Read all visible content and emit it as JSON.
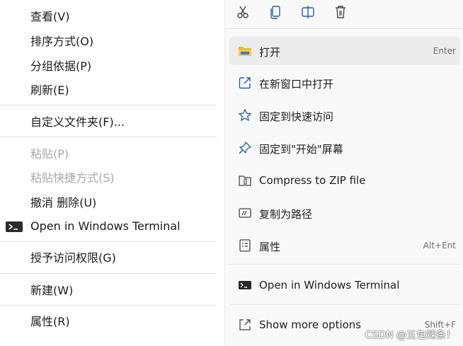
{
  "left_menu": {
    "items": [
      {
        "label": "查看(V)",
        "enabled": true
      },
      {
        "label": "排序方式(O)",
        "enabled": true
      },
      {
        "label": "分组依据(P)",
        "enabled": true
      },
      {
        "label": "刷新(E)",
        "enabled": true
      },
      {
        "label": "自定义文件夹(F)...",
        "enabled": true
      },
      {
        "label": "粘贴(P)",
        "enabled": false
      },
      {
        "label": "粘贴快捷方式(S)",
        "enabled": false
      },
      {
        "label": "撤消 删除(U)",
        "enabled": true
      },
      {
        "label": "Open in Windows Terminal",
        "enabled": true,
        "icon": "terminal-icon"
      },
      {
        "label": "授予访问权限(G)",
        "enabled": true
      },
      {
        "label": "新建(W)",
        "enabled": true
      },
      {
        "label": "属性(R)",
        "enabled": true
      }
    ]
  },
  "right_menu": {
    "toolbar_icons": [
      "cut-icon",
      "copy-icon",
      "rename-icon",
      "delete-icon"
    ],
    "items": [
      {
        "label": "打开",
        "shortcut": "Enter",
        "icon": "folder-icon"
      },
      {
        "label": "在新窗口中打开",
        "icon": "open-new-window-icon"
      },
      {
        "label": "固定到快速访问",
        "icon": "star-icon"
      },
      {
        "label": "固定到\"开始\"屏幕",
        "icon": "pin-icon"
      },
      {
        "label": "Compress to ZIP file",
        "icon": "zip-icon"
      },
      {
        "label": "复制为路径",
        "icon": "copy-path-icon"
      },
      {
        "label": "属性",
        "shortcut": "Alt+Ent",
        "icon": "properties-icon"
      },
      {
        "label": "Open in Windows Terminal",
        "icon": "terminal-icon"
      },
      {
        "label": "Show more options",
        "shortcut": "Shift+F",
        "icon": "more-options-icon"
      }
    ]
  },
  "watermark": "CSDN @五包辣条！",
  "colors": {
    "folder_yellow": "#f2b824",
    "icon_stroke": "#1f5fa8",
    "hover_bg": "#ececec",
    "disabled_text": "#a8a8a8"
  }
}
